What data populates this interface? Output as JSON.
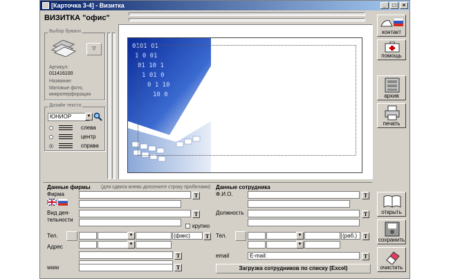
{
  "window": {
    "title": "[Карточка 3-4] - Визитка",
    "min": "_",
    "max": "□",
    "close": "×"
  },
  "app_title": "ВИЗИТКА \"офис\"",
  "paper": {
    "group_title": "Выбор бумаги",
    "article_label": "Артикул:",
    "article_value": "011416100",
    "name_label": "Название:",
    "name_value": "Матовые фото, микроперфорация"
  },
  "text_design": {
    "group_title": "Дизайн текста",
    "font_value": "ЮНИОР",
    "align_options": [
      "слева",
      "центр",
      "справа"
    ],
    "selected_align": "справа"
  },
  "side_buttons": {
    "contact": "контакт",
    "help": "помощь",
    "archive": "архив",
    "print": "печать",
    "open": "открыть",
    "save": "сохранить",
    "clear": "очистить"
  },
  "company": {
    "section_title": "Данные фирмы",
    "hint": "(для сдвига влево дополните строку пробелами)",
    "firm_label": "Фирма",
    "activity_label": "Вид дея-тельности",
    "large_label": "крупно",
    "phone_label": "Тел.",
    "fax_label": "(факс)",
    "address_label": "Адрес",
    "www_label": "www"
  },
  "employee": {
    "section_title": "Данные сотрудника",
    "name_label": "Ф.И.О.",
    "position_label": "Должность",
    "phone_label": "Тел.",
    "work_label": "(раб.)",
    "email_label": "email",
    "email_field": "E-mail:",
    "load_button": "Загрузка сотрудников по списку (Excel)"
  },
  "t_button": "T"
}
